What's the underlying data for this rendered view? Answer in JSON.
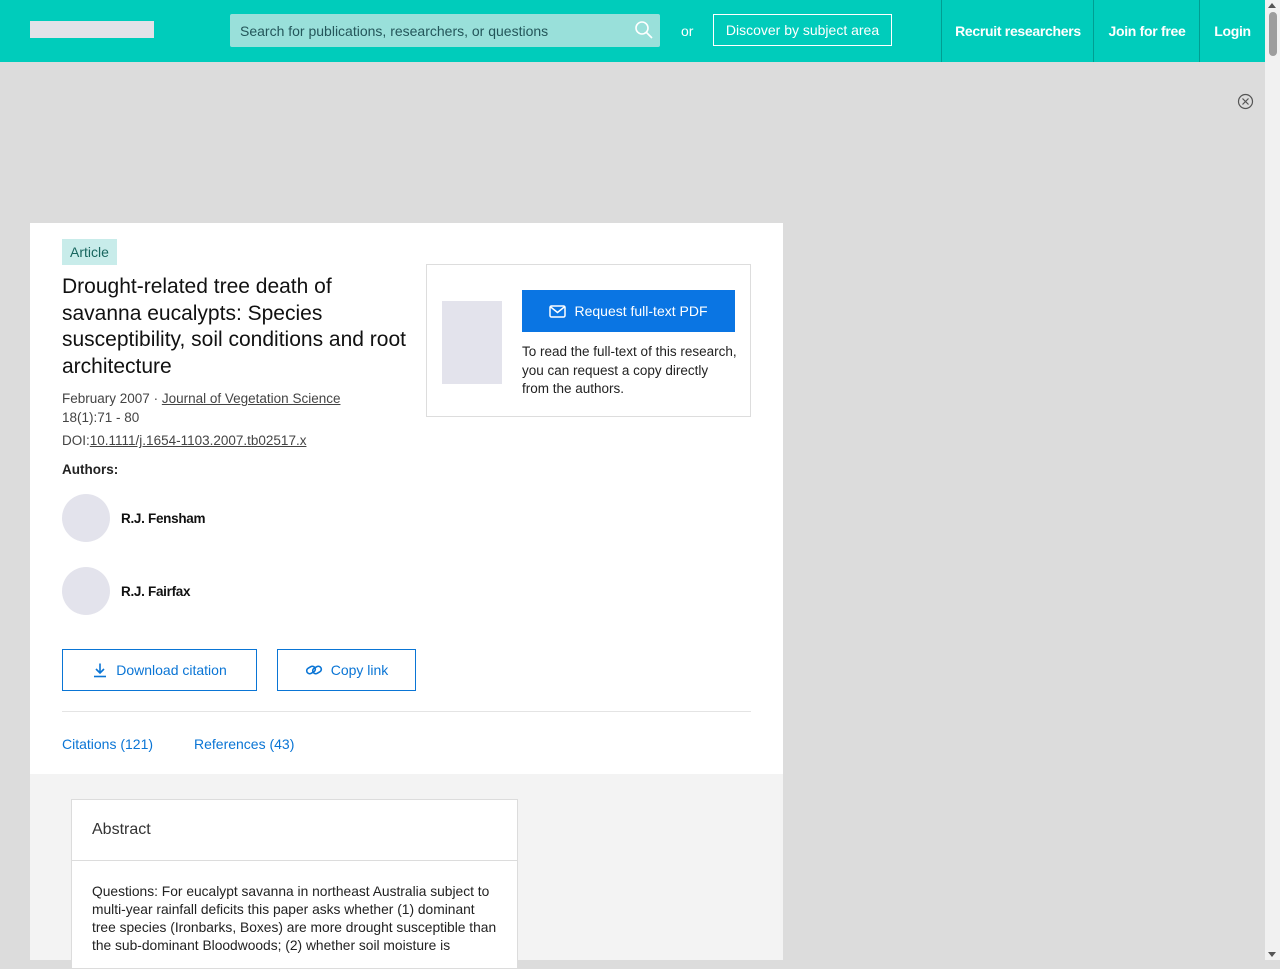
{
  "header": {
    "search_placeholder": "Search for publications, researchers, or questions",
    "or_text": "or",
    "discover_label": "Discover by subject area",
    "nav": [
      "Recruit researchers",
      "Join for free",
      "Login"
    ]
  },
  "article": {
    "type_badge": "Article",
    "title": "Drought-related tree death of savanna eucalypts: Species susceptibility, soil conditions and root architecture",
    "date": "February 2007",
    "separator": "·",
    "journal": "Journal of Vegetation Science",
    "issue": "18(1):71 - 80",
    "doi_label": "DOI:",
    "doi": "10.1111/j.1654-1103.2007.tb02517.x",
    "authors_label": "Authors:",
    "authors": [
      "R.J. Fensham",
      "R.J. Fairfax"
    ],
    "download_citation": "Download citation",
    "copy_link": "Copy link",
    "tabs": [
      "Citations (121)",
      "References (43)"
    ]
  },
  "pdf_request": {
    "button_label": "Request full-text PDF",
    "text": "To read the full-text of this research, you can request a copy directly from the authors."
  },
  "abstract": {
    "heading": "Abstract",
    "body": "Questions: For eucalypt savanna in northeast Australia subject to multi-year rainfall deficits this paper asks whether (1) dominant tree species (Ironbarks, Boxes) are more drought susceptible than the sub-dominant Bloodwoods; (2) whether soil moisture is"
  },
  "colors": {
    "header_bg": "#00ccbb",
    "accent_blue": "#0a75e3",
    "badge_bg": "#c8ecea"
  },
  "icons": [
    "search-icon",
    "close-icon",
    "envelope-icon",
    "download-icon",
    "link-icon"
  ]
}
